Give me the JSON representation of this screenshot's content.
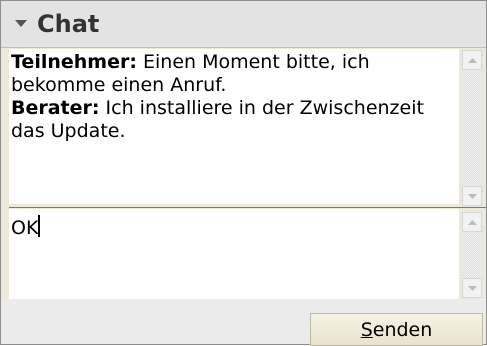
{
  "header": {
    "title": "Chat"
  },
  "messages": [
    {
      "author": "Teilnehmer:",
      "text": " Einen Moment bitte, ich bekomme einen Anruf."
    },
    {
      "author": "Berater:",
      "text": " Ich installiere in der Zwischenzeit das Update."
    }
  ],
  "input": {
    "value": "OK"
  },
  "send_button": {
    "accesskey_letter": "S",
    "rest": "enden"
  },
  "icons": {
    "collapse": "triangle-down-icon",
    "scroll_up": "scroll-up-arrow-icon",
    "scroll_down": "scroll-down-arrow-icon"
  }
}
